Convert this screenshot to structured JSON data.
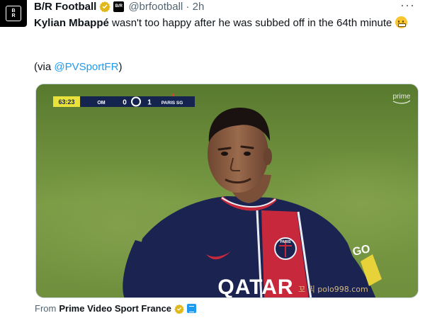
{
  "author": {
    "display_name": "B/R Football",
    "handle": "@brfootball",
    "time": "2h",
    "avatar_text_top": "B",
    "avatar_text_bottom": "R",
    "affiliate_text": "B/R"
  },
  "tweet": {
    "name_bold": "Kylian Mbappé",
    "text": " wasn't too happy after he was subbed off in the 64th minute ",
    "via_prefix": "(via ",
    "via_link": "@PVSportFR",
    "via_suffix": ")"
  },
  "media": {
    "scoreboard": {
      "clock": "63:23",
      "home": "OM",
      "home_score": "0",
      "away_score": "1",
      "away": "PARIS SG"
    },
    "broadcaster_logo": "prime",
    "jersey_sponsor": "QATAR",
    "jersey_crest": "PARIS",
    "watermark": "꼬 픽 polo998.com"
  },
  "source": {
    "prefix": "From",
    "name": "Prime Video Sport France"
  },
  "colors": {
    "accent": "#1d9bf0",
    "verified_gold": "#e2b719",
    "scoreboard_yellow": "#e8e23a",
    "scoreboard_navy": "#14244f",
    "pitch_green": "#6b8a3a",
    "jersey_navy": "#1b2350",
    "jersey_red": "#c8283b"
  }
}
